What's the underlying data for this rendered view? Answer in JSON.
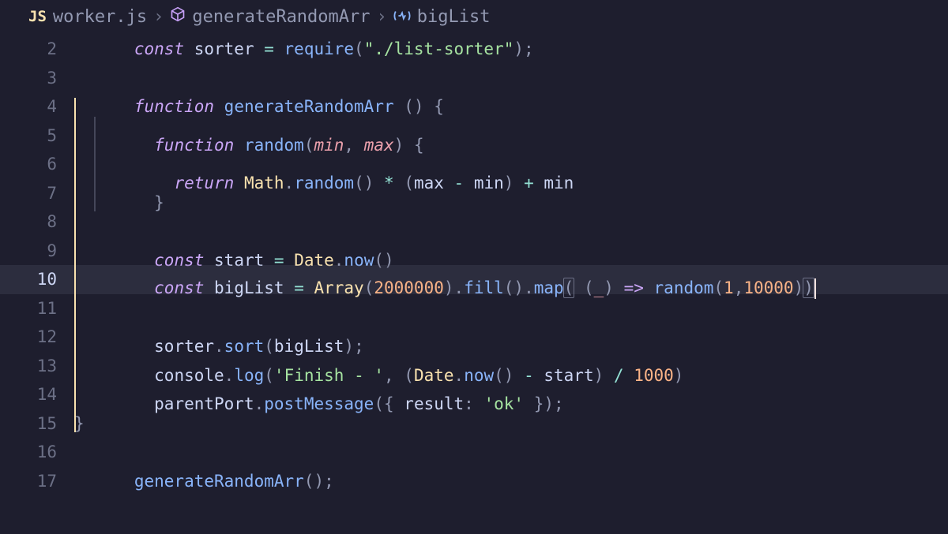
{
  "breadcrumb": {
    "file_badge": "JS",
    "file_name": "worker.js",
    "symbol1": "generateRandomArr",
    "symbol2": "bigList"
  },
  "gutter": {
    "l2": "2",
    "l3": "3",
    "l4": "4",
    "l5": "5",
    "l6": "6",
    "l7": "7",
    "l8": "8",
    "l9": "9",
    "l10": "10",
    "l11": "11",
    "l12": "12",
    "l13": "13",
    "l14": "14",
    "l15": "15",
    "l16": "16",
    "l17": "17"
  },
  "t": {
    "const": "const",
    "function": "function",
    "return": "return",
    "sorter": "sorter",
    "require": "require",
    "req_arg": "\"./list-sorter\"",
    "generateRandomArr": "generateRandomArr",
    "random": "random",
    "min": "min",
    "max": "max",
    "Math": "Math",
    "start": "start",
    "Date": "Date",
    "now": "now",
    "bigList": "bigList",
    "Array": "Array",
    "n2000000": "2000000",
    "fill": "fill",
    "map": "map",
    "underscore": "_",
    "n1": "1",
    "n10000": "10000",
    "sort": "sort",
    "console": "console",
    "log": "log",
    "finish_str": "'Finish - '",
    "n1000": "1000",
    "parentPort": "parentPort",
    "postMessage": "postMessage",
    "result": "result",
    "ok": "'ok'",
    "eq": " = ",
    "star": " * ",
    "minus": " - ",
    "plus": " + ",
    "arrow": " => ",
    "slash": " / ",
    "lcurl": "{",
    "rcurl": "}",
    "lpar": "(",
    "rpar": ")",
    "comma": ",",
    "commasp": ", ",
    "semi": ";",
    "dot": ".",
    "colon": ":",
    "sp": " ",
    "sp2": "  "
  }
}
